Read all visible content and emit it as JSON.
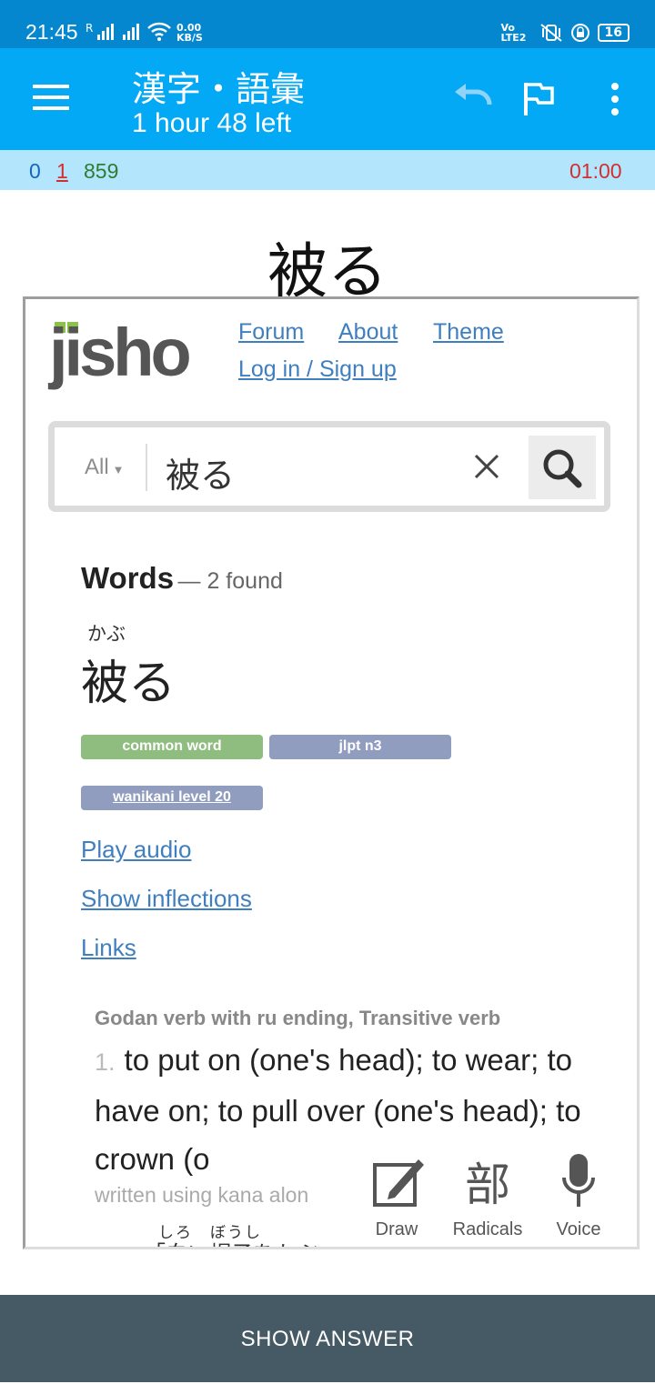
{
  "status_bar": {
    "time": "21:45",
    "signal_marker": "R",
    "net_speed_value": "0.00",
    "net_speed_unit": "KB/S",
    "volte": "Vo LTE2",
    "battery": "16"
  },
  "toolbar": {
    "title": "漢字・語彙",
    "subtitle": "1 hour 48 left",
    "icons": [
      "menu-icon",
      "undo-icon",
      "flag-icon",
      "more-vert-icon"
    ]
  },
  "counts": {
    "new": "0",
    "learning": "1",
    "review": "859",
    "timer": "01:00",
    "colors": {
      "new": "#1565c0",
      "learning": "#d32f2f",
      "review": "#2e7d32",
      "timer": "#d32f2f"
    }
  },
  "question": "被る",
  "jisho": {
    "logo_text": "jisho",
    "nav": {
      "forum": "Forum",
      "about": "About",
      "theme": "Theme",
      "login": "Log in / Sign up"
    },
    "search": {
      "filter": "All",
      "query": "被る"
    },
    "words_heading": "Words",
    "words_count": "— 2 found",
    "result": {
      "furigana": "かぶ",
      "word": "被る",
      "tags": [
        "common word",
        "jlpt n3",
        "wanikani level 20"
      ],
      "links": [
        "Play audio",
        "Show inflections",
        "Links"
      ],
      "part_of_speech": "Godan verb with ru ending, Transitive verb",
      "sense_number": "1.",
      "definition": "to put on (one's head); to wear; to have on; to pull over (one's head); to crown (o",
      "note": "written using kana alon",
      "example_furigana": "しろ　ぼうし",
      "example_text": "「白い帽子をかぶ"
    },
    "tools": {
      "draw": "Draw",
      "radicals_glyph": "部",
      "radicals": "Radicals",
      "voice": "Voice"
    }
  },
  "show_answer": "SHOW ANSWER",
  "accent_colors": {
    "status": "#0587d0",
    "toolbar": "#03a9f4",
    "counts_bg": "#b3e5fc",
    "answer_bar": "#455a64",
    "jisho_link": "#3f7fbf",
    "jisho_green": "#8bc34a"
  }
}
